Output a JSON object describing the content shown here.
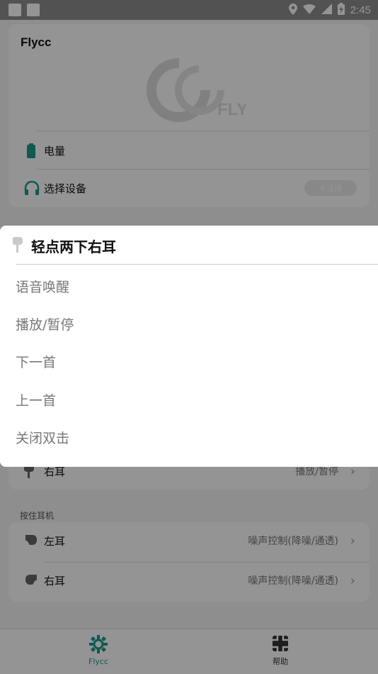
{
  "status_bar": {
    "time": "2:45"
  },
  "app": {
    "title": "Flycc"
  },
  "rows_top": [
    {
      "label": "电量",
      "icon": "battery-icon"
    },
    {
      "label": "选择设备",
      "icon": "headphones-icon",
      "pill": "未连接"
    }
  ],
  "partial_row": {
    "label": "右耳",
    "value": "播放/暂停"
  },
  "press_section": {
    "label": "按住耳机",
    "items": [
      {
        "label": "左耳",
        "value": "噪声控制(降噪/通透)"
      },
      {
        "label": "右耳",
        "value": "噪声控制(降噪/通透)"
      }
    ]
  },
  "bottom_nav": [
    {
      "label": "Flycc",
      "icon": "gear-flower-icon"
    },
    {
      "label": "帮助",
      "icon": "help-icon"
    }
  ],
  "dialog": {
    "title": "轻点两下右耳",
    "options": [
      "语音唤醒",
      "播放/暂停",
      "下一首",
      "上一首",
      "关闭双击"
    ]
  },
  "colors": {
    "accent": "#1a9a8a",
    "dim": "rgba(0,0,0,0.42)"
  }
}
